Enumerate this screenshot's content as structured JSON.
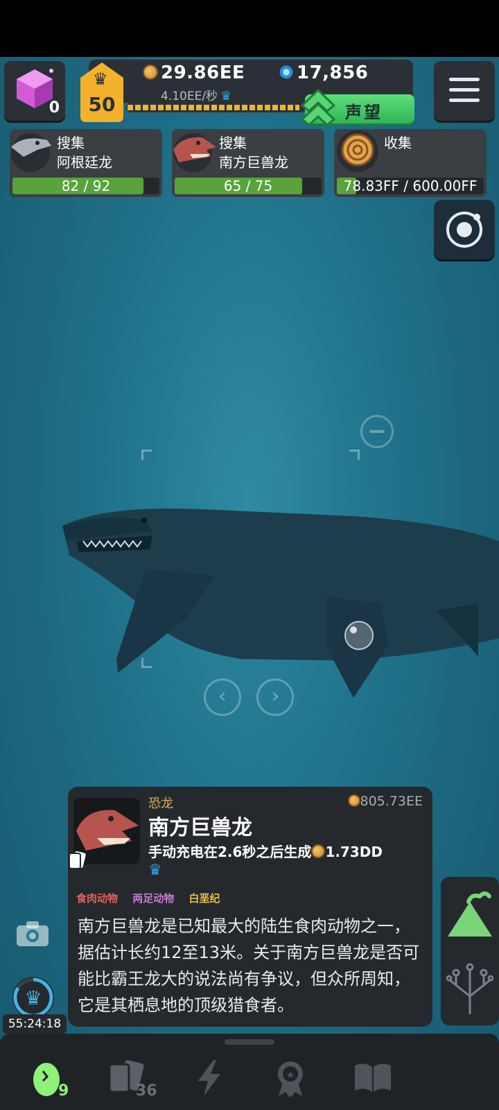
{
  "hud": {
    "gems_count": "0",
    "level": "50",
    "coins": "29.86EE",
    "blue_currency": "17,856",
    "rate": "4.10EE/秒",
    "xp_progress": 0.97,
    "prestige_label": "声望"
  },
  "quests": [
    {
      "title": "搜集",
      "subject": "阿根廷龙",
      "progress": "82 / 92",
      "fraction": 0.891
    },
    {
      "title": "搜集",
      "subject": "南方巨兽龙",
      "progress": "65 / 75",
      "fraction": 0.867
    },
    {
      "title": "收集",
      "subject": "",
      "progress": "78.83FF / 600.00FF",
      "fraction": 0.13
    }
  ],
  "info": {
    "category": "恐龙",
    "value": "805.73EE",
    "name": "南方巨兽龙",
    "generate_text": "手动充电在2.6秒之后生成",
    "generate_amount": "1.73DD",
    "tags": [
      "食肉动物",
      "两足动物",
      "白垩纪"
    ],
    "tag_colors": [
      "#e0625c",
      "#c77ad2",
      "#e8c048"
    ],
    "description": "南方巨兽龙是已知最大的陆生食肉动物之一，据估计长约12至13米。关于南方巨兽龙是否可能比霸王龙大的说法尚有争议，但众所周知，它是其栖息地的顶级猎食者。"
  },
  "timer": "55:24:18",
  "bottom_nav": {
    "eggs_count": "9",
    "cards_count": "36"
  },
  "icons": [
    "gem-icon",
    "crown-icon",
    "coin-icon",
    "blue-star-icon",
    "prestige-chevron-icon",
    "menu-icon",
    "radar-icon",
    "minus-icon",
    "left-arrow-icon",
    "right-arrow-icon",
    "camera-icon",
    "volcano-icon",
    "tree-icon",
    "egg-icon",
    "cards-icon",
    "lightning-icon",
    "medal-icon",
    "book-icon"
  ]
}
